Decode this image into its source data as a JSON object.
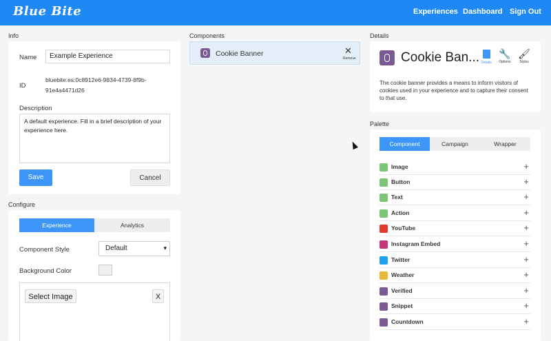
{
  "header": {
    "logo": "Blue Bite",
    "nav": [
      "Experiences",
      "Dashboard",
      "Sign Out"
    ]
  },
  "info": {
    "section_label": "Info",
    "name_label": "Name",
    "name_value": "Example Experience",
    "id_label": "ID",
    "id_value_line1": "bluebite:es:0c8912e6-9834-4739-8f9b-",
    "id_value_line2": "91e4a4471d26",
    "description_label": "Description",
    "description_value": "A default experience. Fill in a brief description of your experience here.",
    "save_label": "Save",
    "cancel_label": "Cancel"
  },
  "configure": {
    "section_label": "Configure",
    "tabs": [
      "Experience",
      "Analytics"
    ],
    "component_style_label": "Component Style",
    "component_style_value": "Default",
    "background_color_label": "Background Color",
    "select_image_label": "Select Image",
    "clear_label": "X"
  },
  "components": {
    "section_label": "Components",
    "item_label": "Cookie Banner",
    "remove_label": "Remove"
  },
  "details": {
    "section_label": "Details",
    "title": "Cookie Ban...",
    "tools": [
      "Details",
      "Options",
      "Styles"
    ],
    "description": "The cookie banner provides a means to inform visitors of cookies used in your experience and to capture their consent to that use."
  },
  "palette": {
    "section_label": "Palette",
    "tabs": [
      "Component",
      "Campaign",
      "Wrapper"
    ],
    "items": [
      {
        "label": "Image",
        "icon": "image-icon",
        "color": "#7cc576"
      },
      {
        "label": "Button",
        "icon": "button-icon",
        "color": "#7cc576"
      },
      {
        "label": "Text",
        "icon": "text-icon",
        "color": "#7cc576"
      },
      {
        "label": "Action",
        "icon": "action-icon",
        "color": "#7cc576"
      },
      {
        "label": "YouTube",
        "icon": "youtube-icon",
        "color": "#e23b2e"
      },
      {
        "label": "Instagram Embed",
        "icon": "instagram-icon",
        "color": "#c8367a"
      },
      {
        "label": "Twitter",
        "icon": "twitter-icon",
        "color": "#1da1f2"
      },
      {
        "label": "Weather",
        "icon": "weather-icon",
        "color": "#e8b93a"
      },
      {
        "label": "Verified",
        "icon": "verified-icon",
        "color": "#7a5a94"
      },
      {
        "label": "Snippet",
        "icon": "snippet-icon",
        "color": "#7a5a94"
      },
      {
        "label": "Countdown",
        "icon": "countdown-icon",
        "color": "#7a5a94"
      }
    ]
  },
  "colors": {
    "brand_blue": "#1e88f5",
    "accent_blue": "#3d96f7",
    "component_purple": "#7a5a94"
  }
}
